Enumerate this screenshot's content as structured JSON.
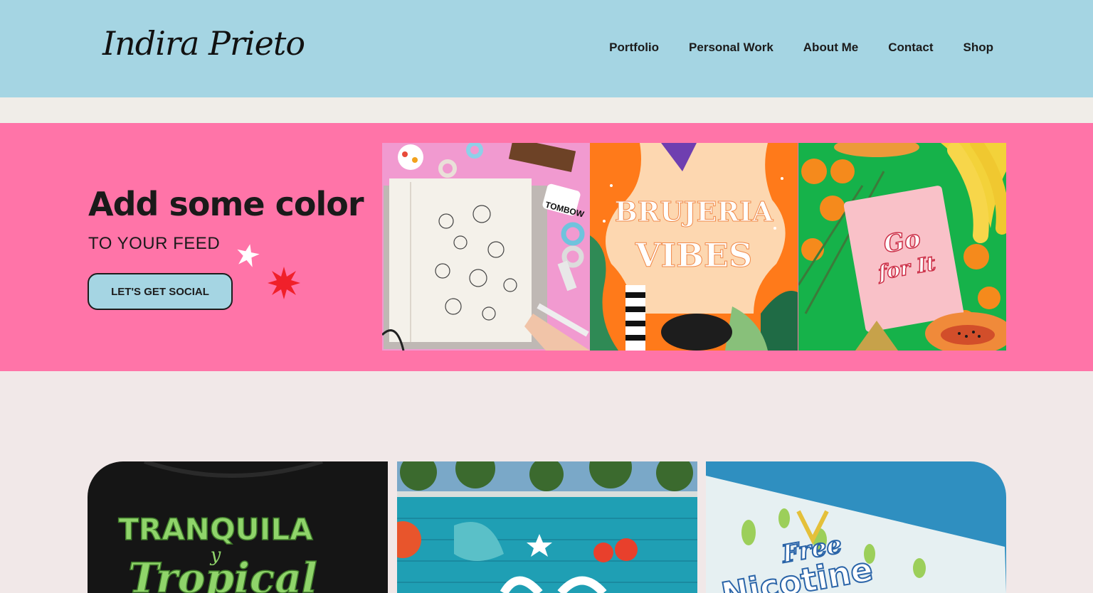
{
  "header": {
    "logo_text": "Indira Prieto",
    "nav": [
      "Portfolio",
      "Personal Work",
      "About Me",
      "Contact",
      "Shop"
    ]
  },
  "hero": {
    "title": "Add some color",
    "subtitle": "TO YOUR FEED",
    "cta_label": "LET'S GET SOCIAL",
    "tiles": [
      {
        "caption": "TOMBOW"
      },
      {
        "line1": "BRUJERIA",
        "line2": "VIBES"
      },
      {
        "line1": "Go",
        "line2": "for It"
      }
    ]
  },
  "gallery": [
    {
      "line1": "TRANQUILA",
      "line2": "y",
      "line3": "Tropical"
    },
    {
      "text": ""
    },
    {
      "line1": "Free",
      "line2": "Nicotine"
    }
  ],
  "colors": {
    "header_bg": "#a5d5e3",
    "hero_bg": "#ff74a8",
    "page_bg": "#f1e8e8"
  }
}
